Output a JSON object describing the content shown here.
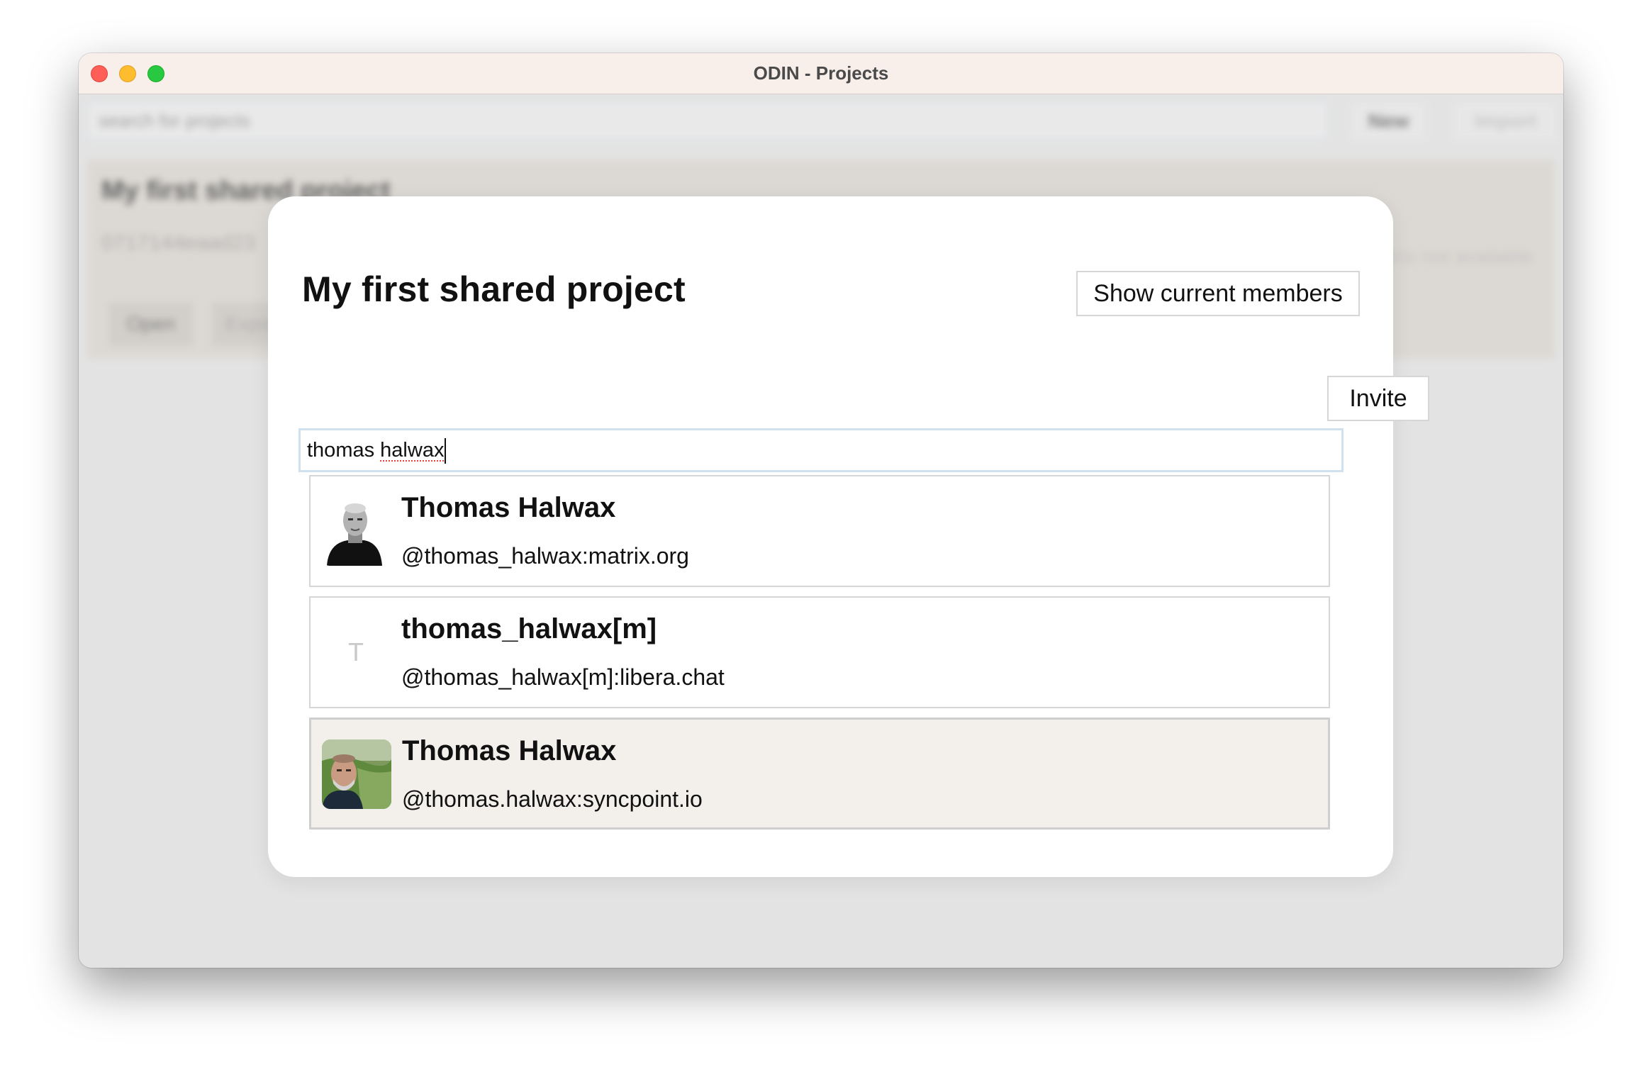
{
  "window": {
    "title": "ODIN - Projects",
    "controls": [
      "close-icon",
      "minimize-icon",
      "zoom-icon"
    ]
  },
  "background": {
    "search_placeholder": "search for projects",
    "new_label": "New",
    "import_label": "Import",
    "project_card": {
      "title": "My first shared project",
      "id": "0717144eaad23",
      "status": "Matrix not available",
      "open_label": "Open",
      "export_label": "Export"
    }
  },
  "modal": {
    "title": "My first shared project",
    "show_members_label": "Show current members",
    "invite_label": "Invite",
    "search": {
      "value_prefix": "thomas ",
      "value_misspelled": "halwax"
    },
    "results": [
      {
        "display_name": "Thomas Halwax",
        "user_id": "@thomas_halwax:matrix.org",
        "avatar": "photo-bw-portrait",
        "selected": false
      },
      {
        "display_name": "thomas_halwax[m]",
        "user_id": "@thomas_halwax[m]:libera.chat",
        "avatar_letter": "T",
        "selected": false
      },
      {
        "display_name": "Thomas Halwax",
        "user_id": "@thomas.halwax:syncpoint.io",
        "avatar": "photo-color-outdoor",
        "selected": true
      }
    ]
  },
  "colors": {
    "close": "#ff5f57",
    "minimize": "#febc2e",
    "zoom": "#28c840",
    "selected_row": "#f3f0ec",
    "input_focus_border": "#cfe0ee"
  }
}
